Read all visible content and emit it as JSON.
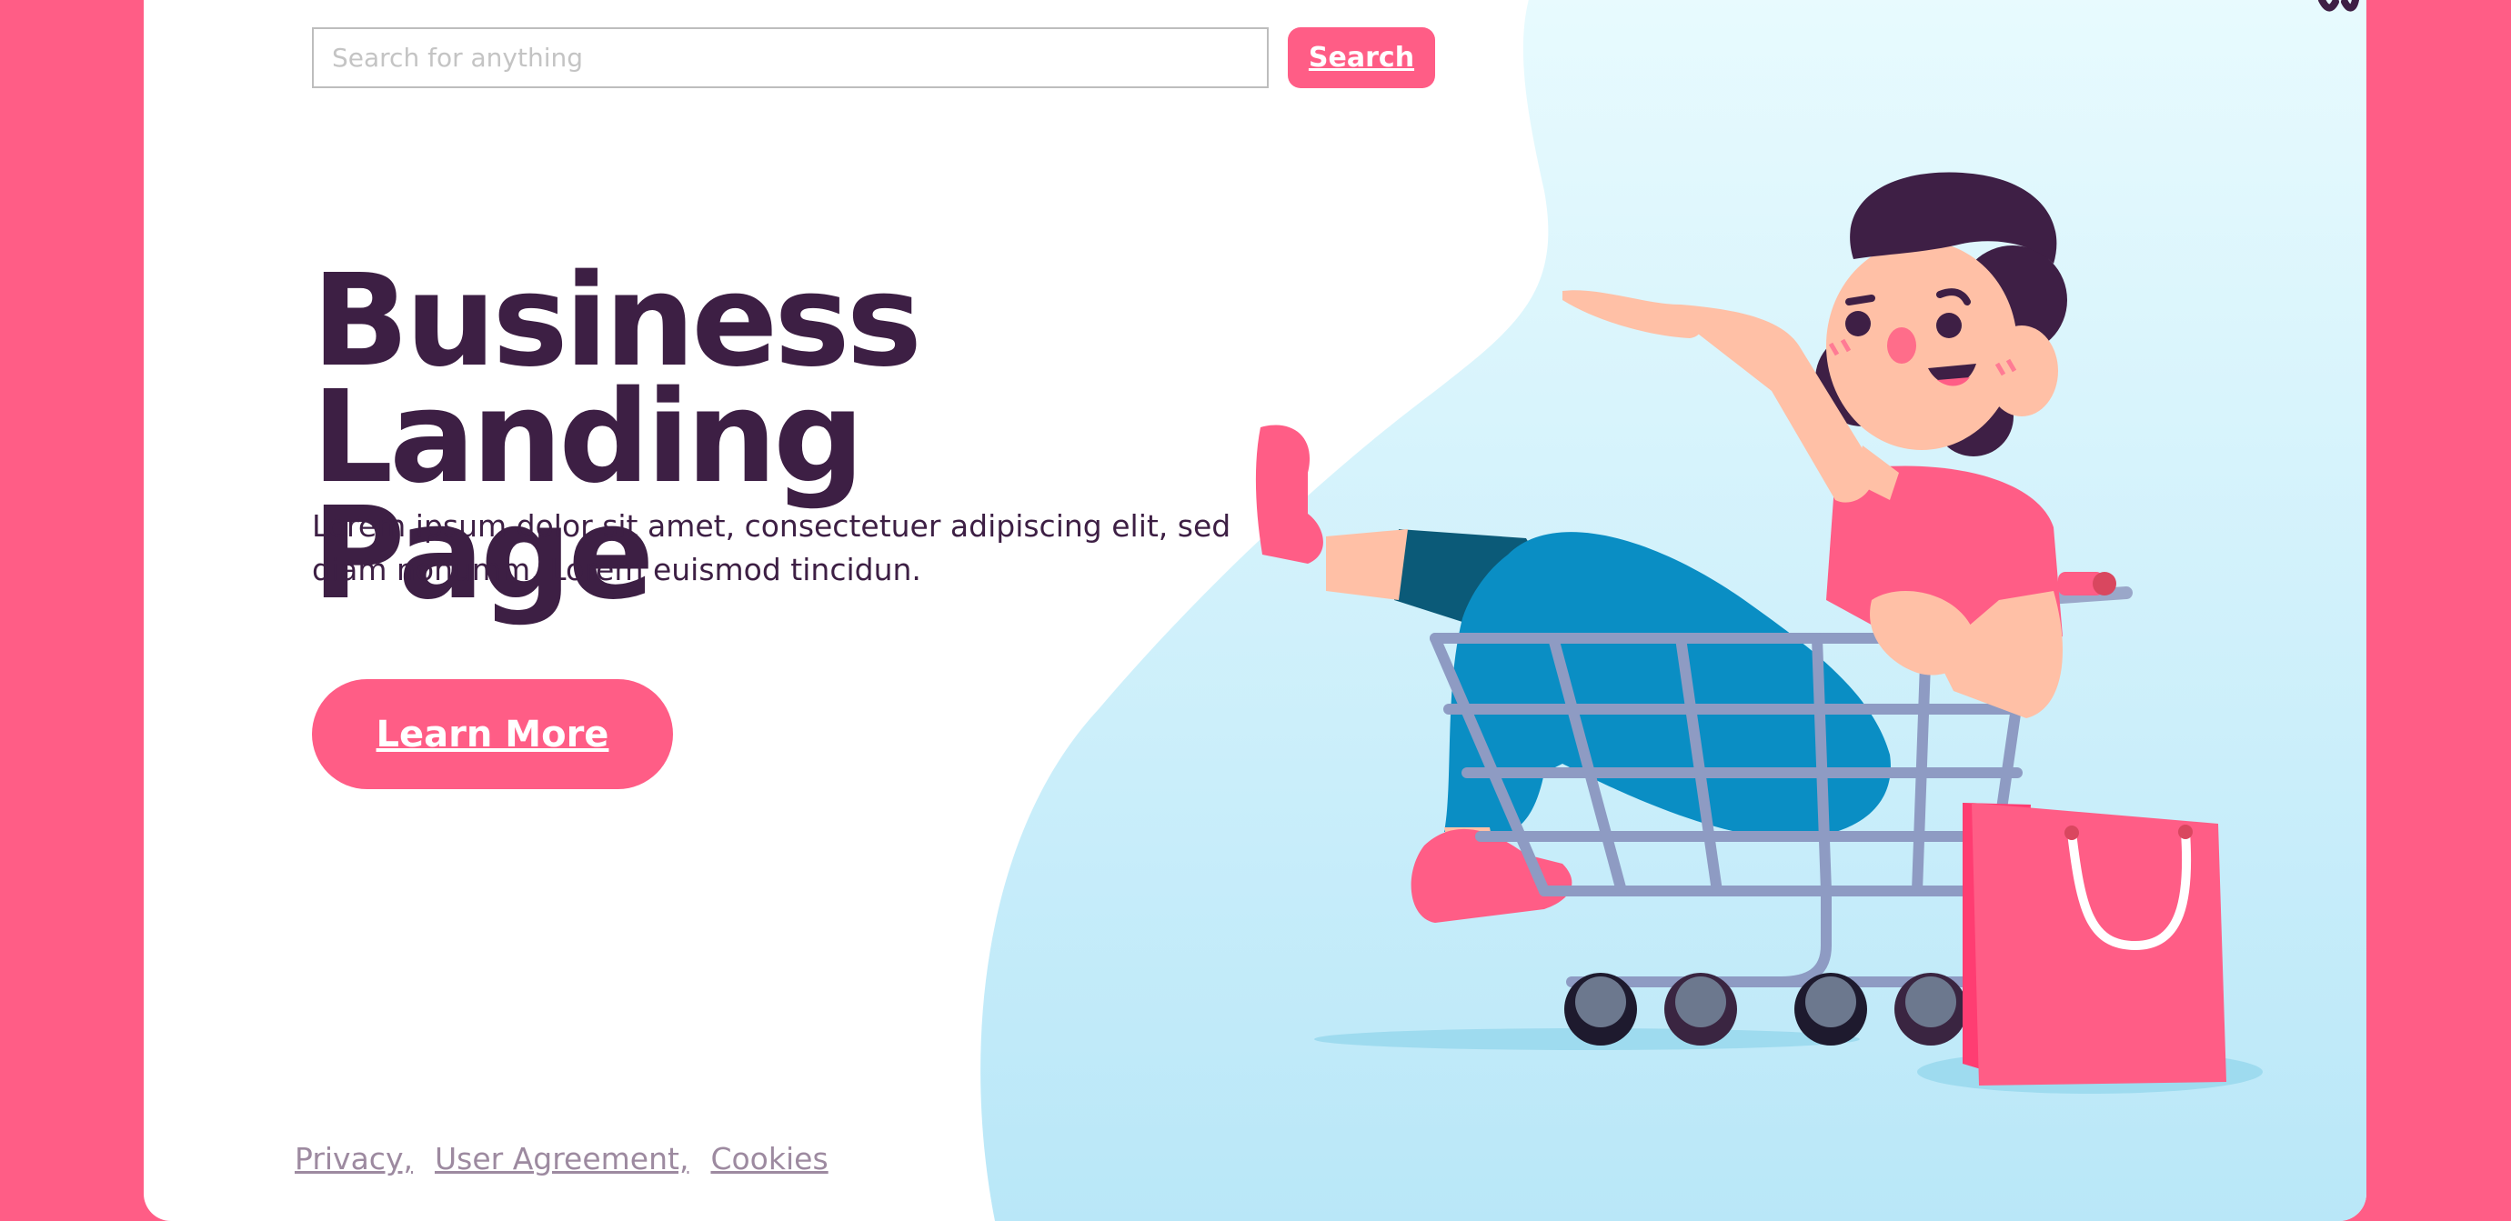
{
  "search": {
    "placeholder": "Search for anything",
    "value": "",
    "button_label": "Search"
  },
  "hero": {
    "title_line1": "Business",
    "title_line2": "Landing Page",
    "tagline": "Lorem ipsum dolor sit amet, consectetuer adipiscing elit, sed diam nonumm. Lorem euismod tincidun.",
    "cta_label": "Learn More"
  },
  "footer": {
    "links": [
      "Privacy,",
      "User Agreement,",
      "Cookies"
    ]
  },
  "colors": {
    "accent": "#ff5d86",
    "title": "#3d1f44",
    "blob_top": "#e8fbfe",
    "blob_bottom": "#bdeaf9"
  },
  "illustration": {
    "subject": "woman-in-shopping-cart-illustration",
    "icons": [
      "shopping-cart-icon",
      "shopping-bag-icon"
    ]
  }
}
